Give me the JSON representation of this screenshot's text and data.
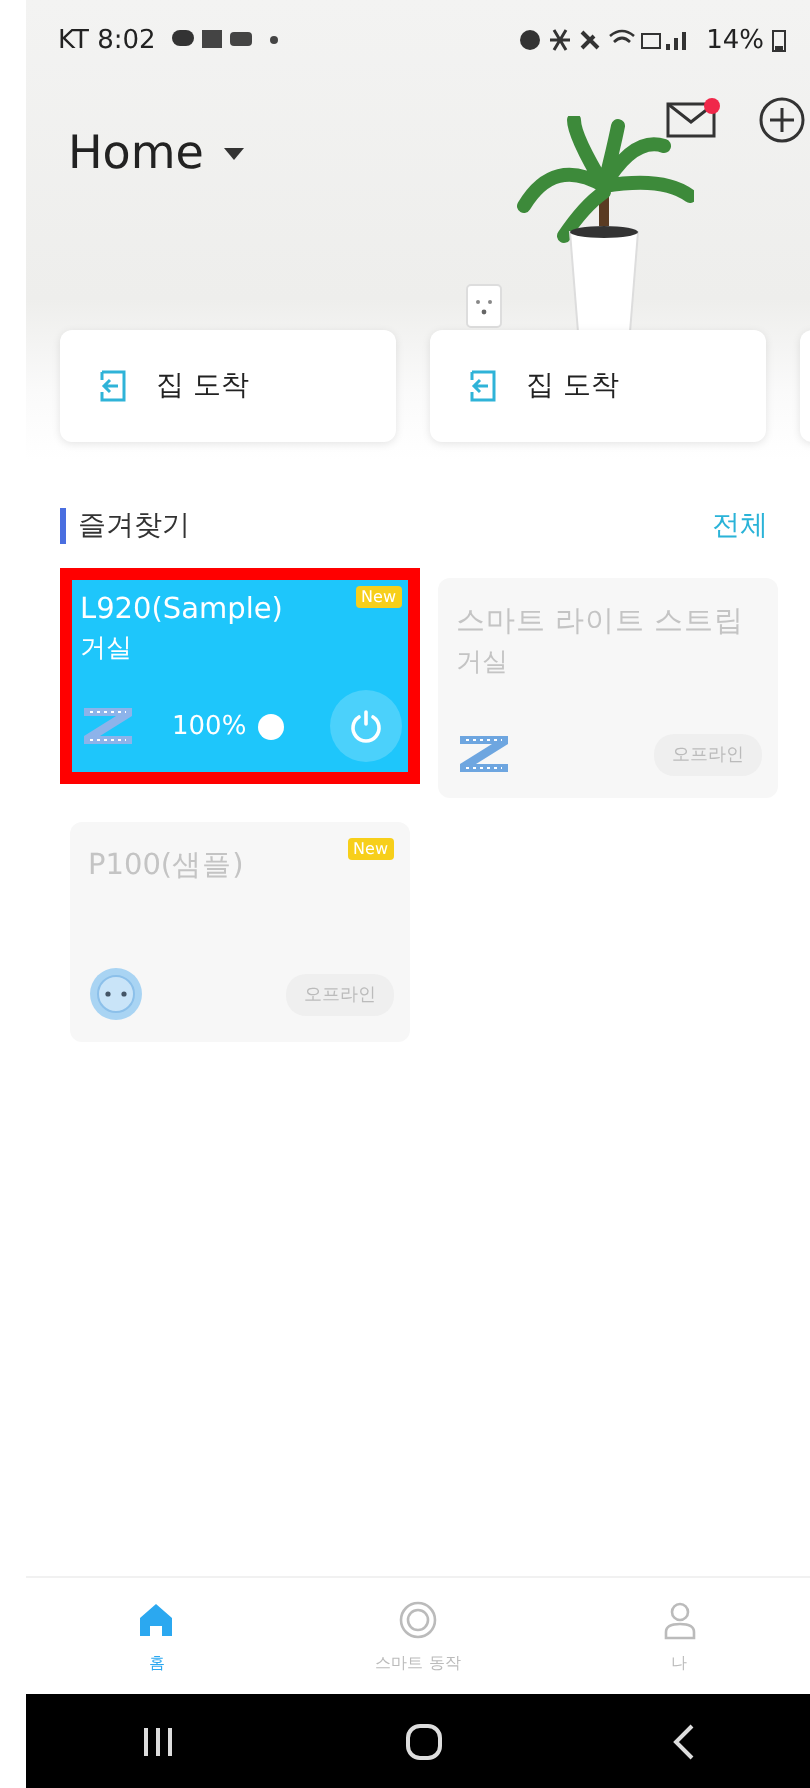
{
  "status_bar": {
    "carrier_time": "KT 8:02",
    "battery": "14%"
  },
  "header": {
    "home_title": "Home",
    "has_unread": true
  },
  "scenes": [
    {
      "label": "집 도착"
    },
    {
      "label": "집 도착"
    }
  ],
  "favorites": {
    "title": "즐겨찾기",
    "see_all": "전체",
    "devices": [
      {
        "kind": "strip",
        "name": "L920(Sample)",
        "room": "거실",
        "online": true,
        "new_badge": "New",
        "highlighted": true,
        "brightness": "100%",
        "on": true
      },
      {
        "kind": "strip",
        "name": "스마트 라이트 스트립",
        "room": "거실",
        "online": false,
        "highlighted": false,
        "status": "오프라인"
      },
      {
        "kind": "plug",
        "name": "P100(샘플)",
        "online": false,
        "new_badge": "New",
        "highlighted": false,
        "status": "오프라인"
      }
    ]
  },
  "bottom_nav": [
    {
      "label": "홈",
      "selected": true
    },
    {
      "label": "스마트 동작",
      "selected": false
    },
    {
      "label": "나",
      "selected": false
    }
  ]
}
